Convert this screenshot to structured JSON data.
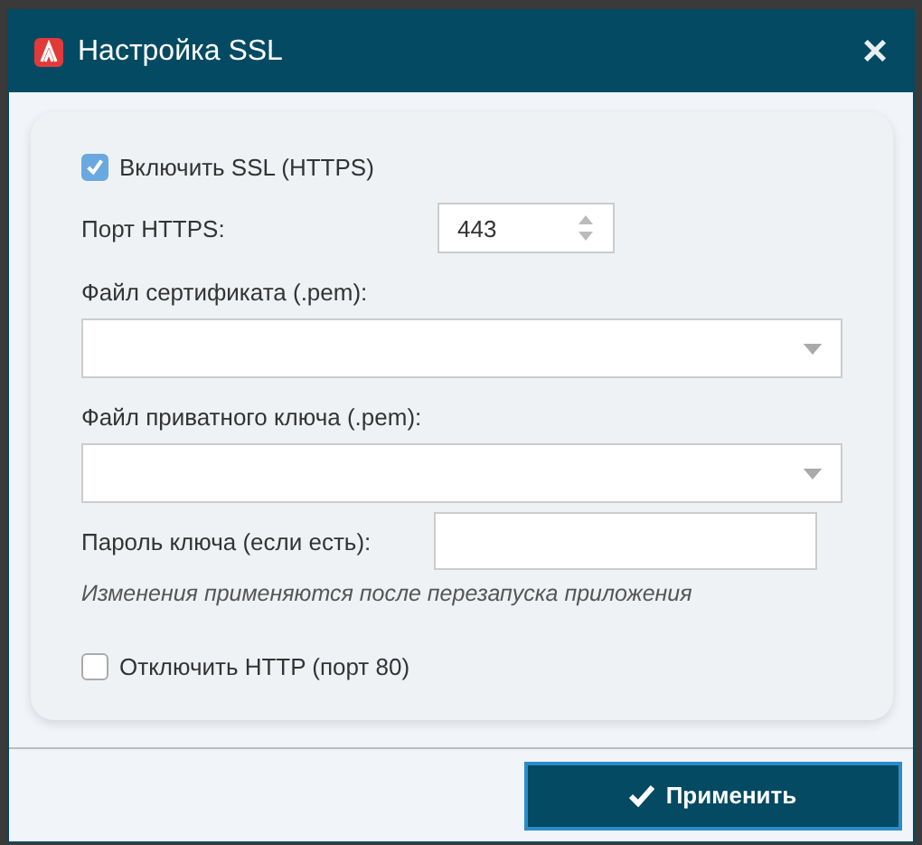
{
  "window": {
    "title": "Настройка SSL",
    "close": "×"
  },
  "enable_ssl": {
    "label": "Включить SSL (HTTPS)",
    "checked": true
  },
  "port": {
    "label": "Порт HTTPS:",
    "value": "443"
  },
  "cert_file": {
    "label": "Файл сертификата (.pem):"
  },
  "key_file": {
    "label": "Файл приватного ключа (.pem):"
  },
  "key_password": {
    "label": "Пароль ключа (если есть):"
  },
  "note": "Изменения применяются после перезапуска приложения",
  "disable_http": {
    "label": "Отключить HTTP (порт 80)",
    "checked": false
  },
  "apply_button": "Применить"
}
